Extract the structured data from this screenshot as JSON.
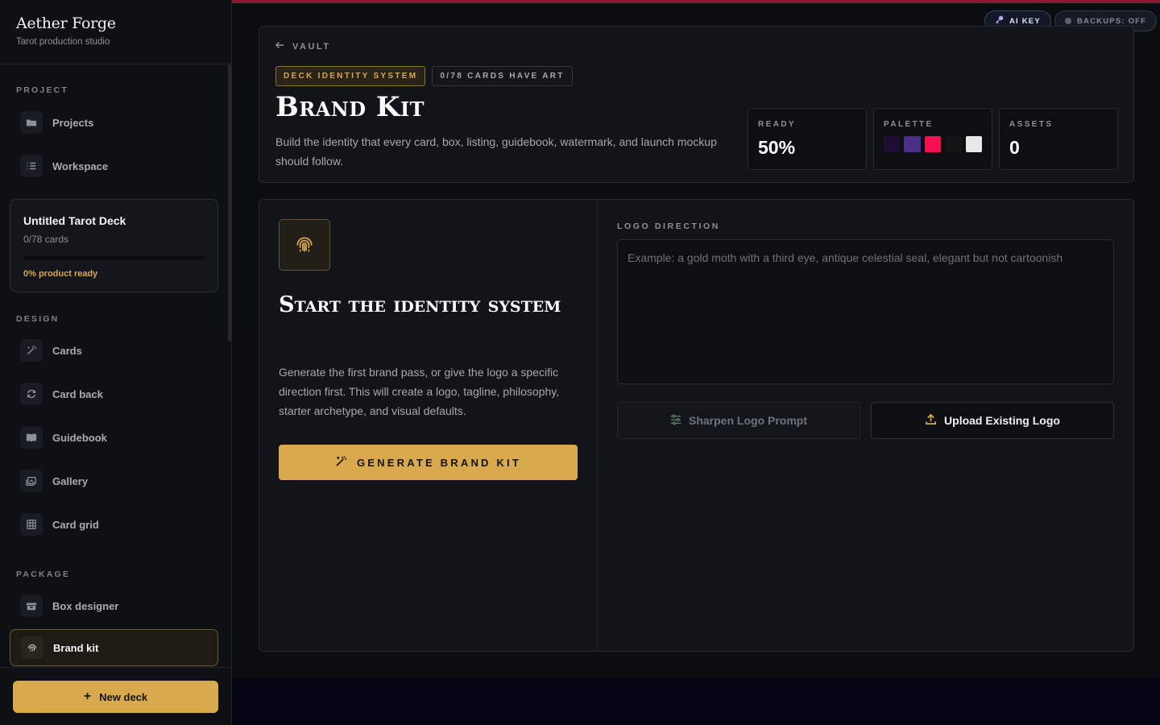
{
  "app": {
    "title": "Aether Forge",
    "subtitle": "Tarot production studio"
  },
  "sidebar": {
    "sections": {
      "project": "PROJECT",
      "design": "DESIGN",
      "package": "PACKAGE"
    },
    "project_items": [
      {
        "label": "Projects",
        "icon": "folder-icon"
      },
      {
        "label": "Workspace",
        "icon": "list-icon"
      }
    ],
    "deck": {
      "name": "Untitled Tarot Deck",
      "count": "0/78 cards",
      "progress": 0,
      "ready_text": "0% product ready"
    },
    "design_items": [
      {
        "label": "Cards",
        "icon": "magic-wand-icon"
      },
      {
        "label": "Card back",
        "icon": "repeat-icon"
      },
      {
        "label": "Guidebook",
        "icon": "book-icon"
      },
      {
        "label": "Gallery",
        "icon": "gallery-icon"
      },
      {
        "label": "Card grid",
        "icon": "grid-icon"
      }
    ],
    "package_items": [
      {
        "label": "Box designer",
        "icon": "box-icon"
      },
      {
        "label": "Brand kit",
        "icon": "fingerprint-icon",
        "active": true
      }
    ],
    "new_deck_label": "New deck"
  },
  "topbar": {
    "ai_key_label": "AI KEY",
    "backups_label": "BACKUPS: OFF",
    "accent": "#8e1838"
  },
  "hero": {
    "back_label": "VAULT",
    "tag_identity": "DECK IDENTITY SYSTEM",
    "tag_art": "0/78 CARDS HAVE ART",
    "title": "Brand Kit",
    "description": "Build the identity that every card, box, listing, guidebook, watermark, and launch mockup should follow.",
    "stats": {
      "ready_label": "READY",
      "ready_value": "50%",
      "palette_label": "PALETTE",
      "palette": [
        "#1e0e33",
        "#4b2f86",
        "#f5104f",
        "#141414",
        "#e8e8e8"
      ],
      "assets_label": "ASSETS",
      "assets_value": "0"
    }
  },
  "identity": {
    "title": "Start the identity system",
    "description": "Generate the first brand pass, or give the logo a specific direction first. This will create a logo, tagline, philosophy, starter archetype, and visual defaults.",
    "generate_label": "GENERATE BRAND KIT",
    "logo_label": "LOGO DIRECTION",
    "logo_placeholder": "Example: a gold moth with a third eye, antique celestial seal, elegant but not cartoonish",
    "sharpen_label": "Sharpen Logo Prompt",
    "upload_label": "Upload Existing Logo"
  },
  "colors": {
    "gold": "#d9a94e"
  }
}
